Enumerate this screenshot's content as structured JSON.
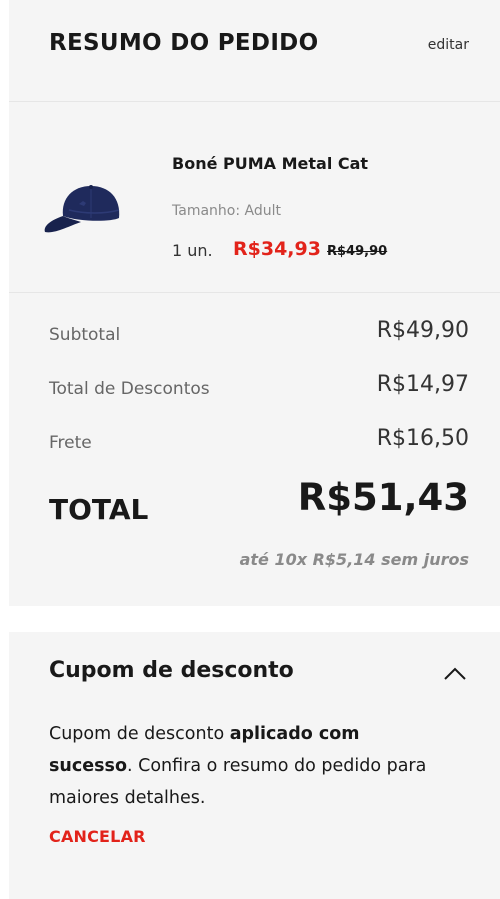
{
  "summary": {
    "title": "RESUMO DO PEDIDO",
    "edit_label": "editar"
  },
  "product": {
    "name": "Boné PUMA Metal Cat",
    "size": "Tamanho: Adult",
    "quantity": "1 un.",
    "price": "R$34,93",
    "original_price": "R$49,90",
    "image_icon": "navy-cap-image"
  },
  "totals": {
    "subtotal_label": "Subtotal",
    "subtotal_value": "R$49,90",
    "discounts_label": "Total de Descontos",
    "discounts_value": "R$14,97",
    "shipping_label": "Frete",
    "shipping_value": "R$16,50",
    "total_label": "TOTAL",
    "total_value": "R$51,43",
    "installments": "até 10x R$5,14 sem juros"
  },
  "coupon": {
    "title": "Cupom de desconto",
    "msg_part1": "Cupom de desconto ",
    "msg_bold": "aplicado com sucesso",
    "msg_part2": ". Confira o resumo do pedido para maiores detalhes.",
    "cancel_label": "CANCELAR",
    "toggle_icon": "chevron-up-icon"
  },
  "colors": {
    "accent_red": "#e2231a",
    "panel_bg": "#f5f5f5",
    "cap_navy": "#1f2a5c"
  }
}
